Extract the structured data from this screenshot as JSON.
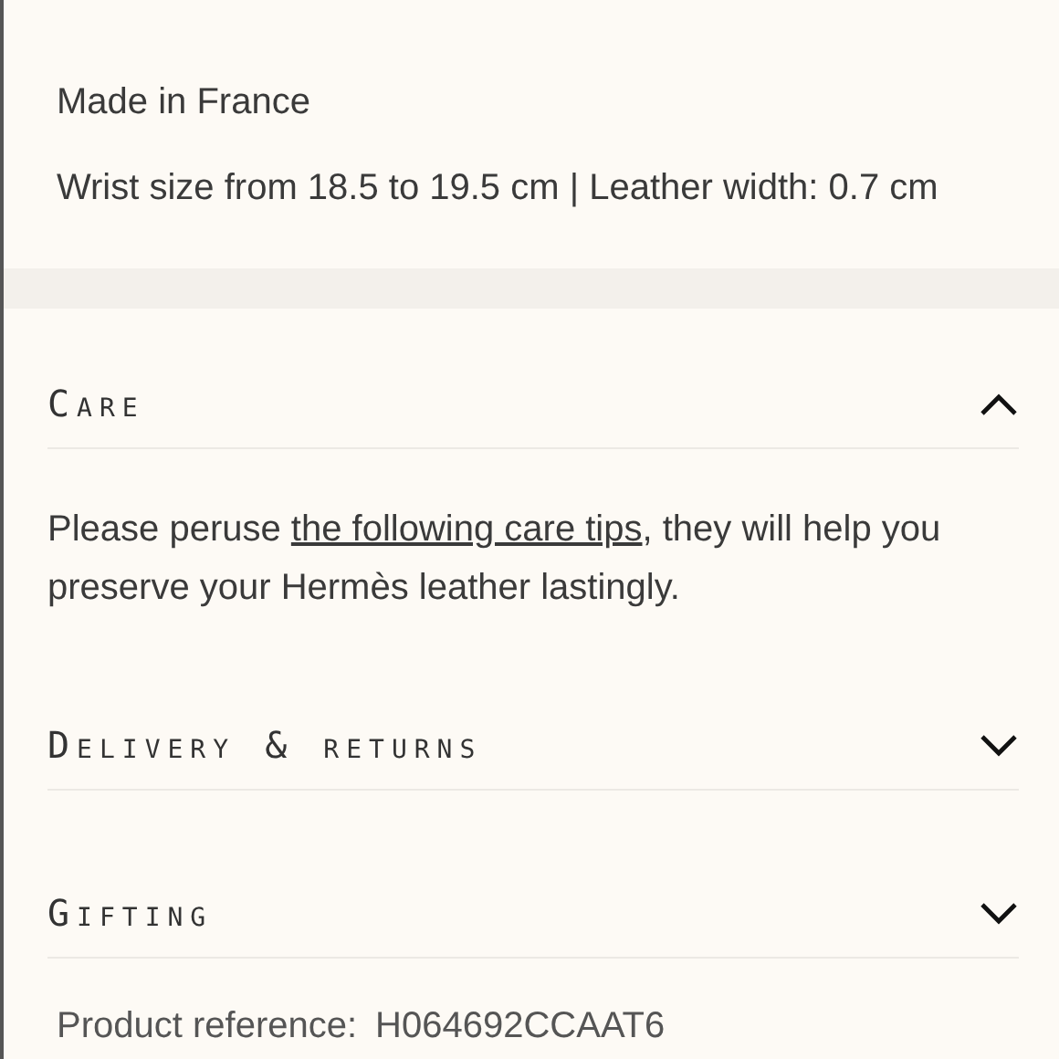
{
  "details": [
    "Made in France",
    "Wrist size from 18.5 to 19.5 cm | Leather width: 0.7 cm"
  ],
  "sections": [
    {
      "title": "Care",
      "expanded": true,
      "body": {
        "text_before": "Please peruse ",
        "link": "the following care tips",
        "text_after": ", they will help you preserve your Hermès leather lastingly."
      }
    },
    {
      "title": "Delivery & returns",
      "expanded": false
    },
    {
      "title": "Gifting",
      "expanded": false
    }
  ],
  "product_reference": {
    "label": "Product reference:",
    "value": "H064692CCAAT6"
  }
}
